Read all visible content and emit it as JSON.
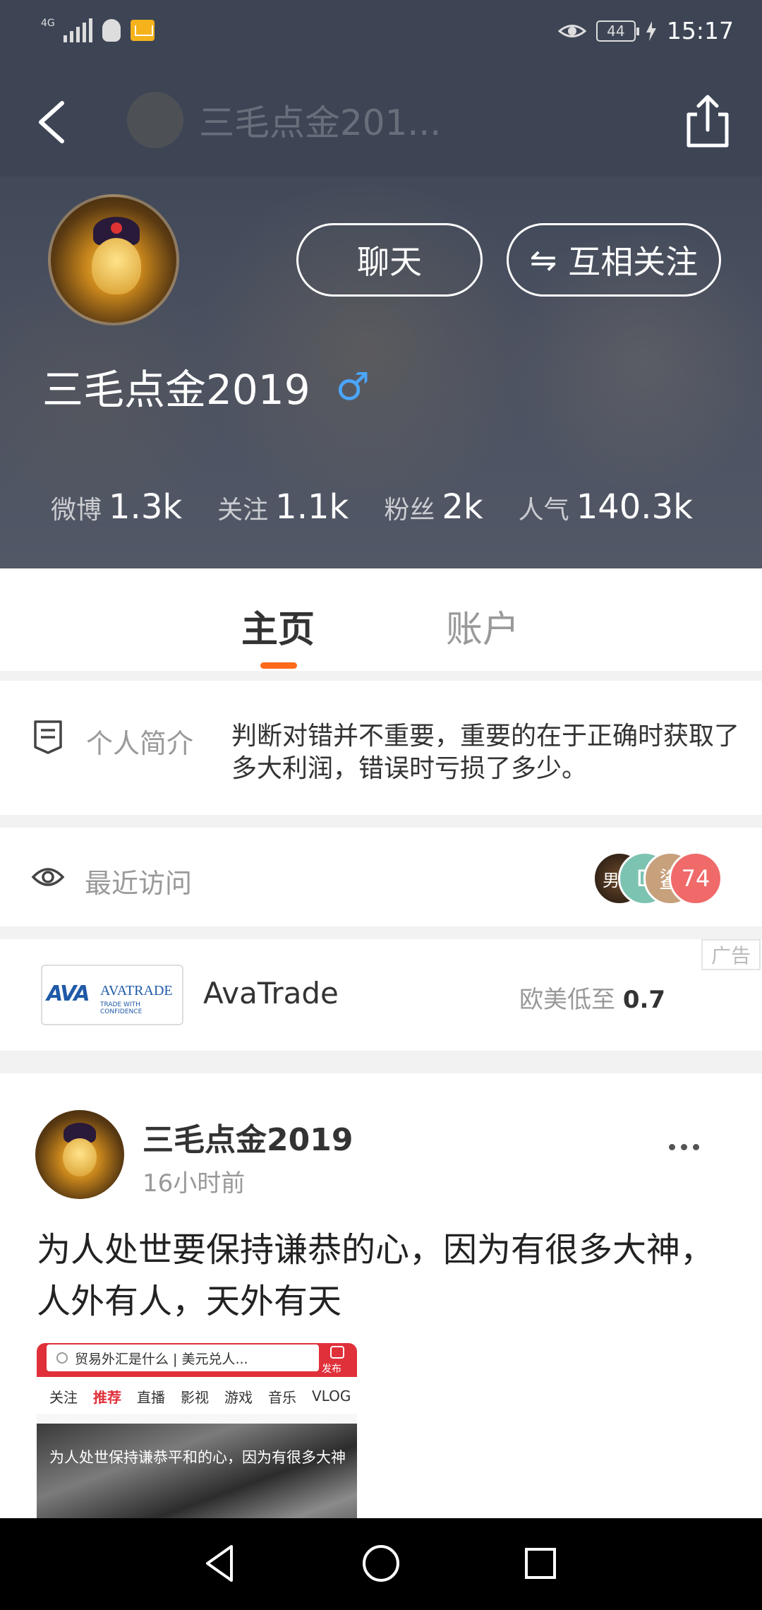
{
  "status_bar": {
    "network": "4G",
    "battery": "44",
    "time": "15:17"
  },
  "nav": {
    "title": "三毛点金201...",
    "back_icon": "chevron-left-icon",
    "share_icon": "share-icon"
  },
  "profile": {
    "name": "三毛点金2019",
    "gender_symbol": "♂",
    "chat_label": "聊天",
    "follow_label": "互相关注",
    "follow_symbol": "⇋",
    "stats": [
      {
        "label": "微博",
        "value": "1.3k"
      },
      {
        "label": "关注",
        "value": "1.1k"
      },
      {
        "label": "粉丝",
        "value": "2k"
      },
      {
        "label": "人气",
        "value": "140.3k"
      }
    ]
  },
  "tabs": [
    {
      "label": "主页",
      "active": true
    },
    {
      "label": "账户",
      "active": false
    }
  ],
  "intro": {
    "label": "个人简介",
    "text": "判断对错并不重要，重要的在于正确时获取了多大利润，错误时亏损了多少。"
  },
  "recent": {
    "label": "最近访问",
    "visitors": [
      "男人",
      "D",
      "鲨",
      "74"
    ]
  },
  "ad": {
    "tag": "广告",
    "logo_mark": "AVA",
    "logo_word": "AVATRADE",
    "logo_tagline": "TRADE WITH CONFIDENCE",
    "name": "AvaTrade",
    "desc_prefix": "欧美低至",
    "desc_value": "0.7"
  },
  "post": {
    "author": "三毛点金2019",
    "time": "16小时前",
    "text": "为人处世要保持谦恭的心，因为有很多大神，人外有人，天外有天",
    "image": {
      "search_text": "贸易外汇是什么 | 美元兑人...",
      "publish_label": "发布",
      "nav": [
        "关注",
        "推荐",
        "直播",
        "影视",
        "游戏",
        "音乐",
        "VLOG"
      ],
      "caption": "为人处世保持谦恭平和的心，因为有很多大神"
    }
  },
  "colors": {
    "accent": "#ff6a1a",
    "male_blue": "#4aa6ff",
    "header_bg": "#3d4555"
  }
}
